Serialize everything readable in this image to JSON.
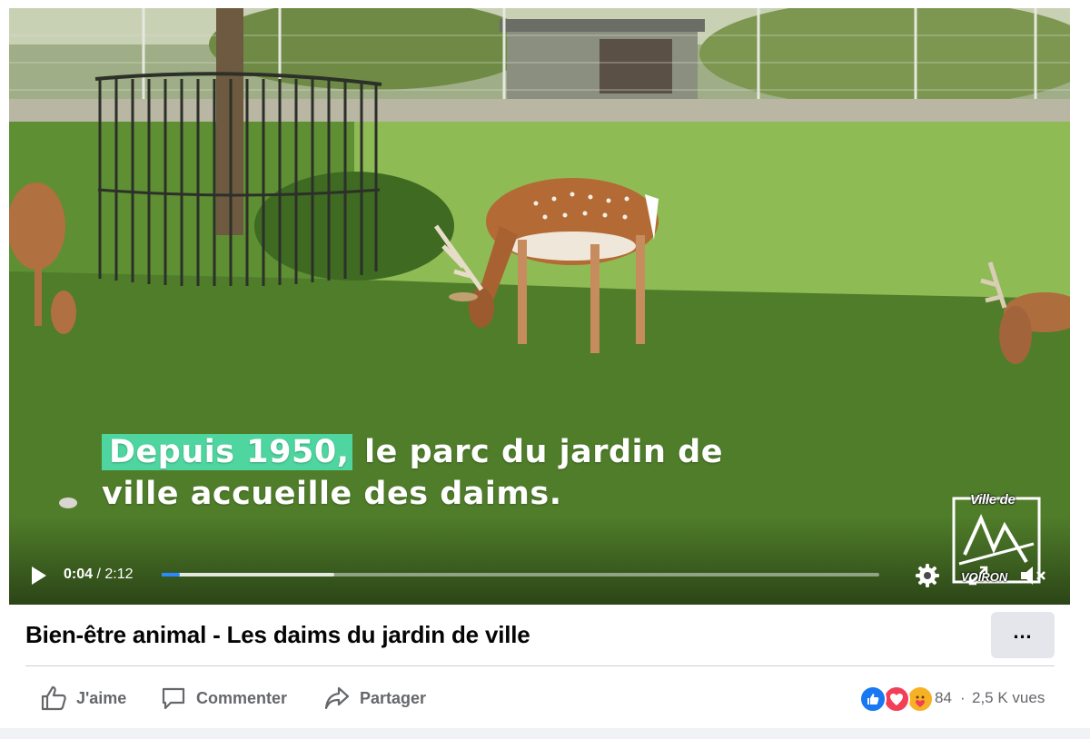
{
  "video": {
    "caption_highlight": "Depuis 1950,",
    "caption_line1_rest": " le parc du jardin de",
    "caption_line2": "ville accueille des daims.",
    "logo_top": "Ville de",
    "logo_bottom": "VOIRON",
    "current_time": "0:04",
    "separator": " / ",
    "duration": "2:12",
    "progress_played_fraction": 0.025,
    "progress_buffered_fraction": 0.24,
    "accent_color": "#4fd6a0",
    "progress_color": "#2d88ff"
  },
  "post": {
    "title": "Bien-être animal - Les daims du jardin de ville",
    "more_label": "…"
  },
  "actions": {
    "like_label": "J'aime",
    "comment_label": "Commenter",
    "share_label": "Partager"
  },
  "stats": {
    "reactions": [
      "like-icon",
      "love-icon",
      "care-icon"
    ],
    "reaction_count": "84",
    "separator": "·",
    "views": "2,5 K vues"
  }
}
